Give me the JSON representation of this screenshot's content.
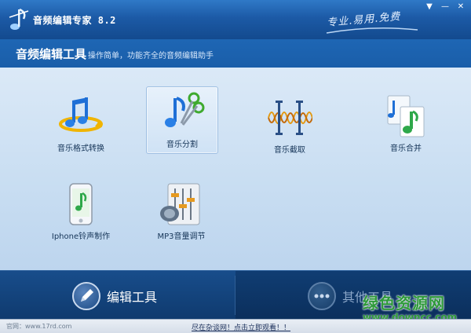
{
  "window": {
    "title": "音频编辑专家 8.2",
    "slogan": "专业.易用.免费",
    "controls": [
      "▼",
      "—",
      "✕"
    ]
  },
  "header": {
    "title": "音频编辑工具",
    "subtitle": "操作简单，功能齐全的音频编辑助手"
  },
  "tools": [
    {
      "label": "音乐格式转换",
      "icon": "music-convert-icon"
    },
    {
      "label": "音乐分割",
      "icon": "music-split-icon",
      "selected": true
    },
    {
      "label": "音乐截取",
      "icon": "music-cut-icon"
    },
    {
      "label": "音乐合并",
      "icon": "music-merge-icon"
    },
    {
      "label": "Iphone铃声制作",
      "icon": "iphone-ringtone-icon"
    },
    {
      "label": "MP3音量调节",
      "icon": "mp3-volume-icon"
    }
  ],
  "bottom_tabs": [
    {
      "label": "编辑工具",
      "icon": "pen-icon",
      "active": true
    },
    {
      "label": "其他工具",
      "icon": "more-icon",
      "active": false
    }
  ],
  "status": {
    "left": "官网：www.17rd.com",
    "center": "尽在杂谈网！点击立即观看！！"
  },
  "watermark": {
    "line1": "绿色资源网",
    "line2": "www.downcc.com"
  },
  "colors": {
    "titlebar": "#1c5aa6",
    "content_bg": "#c9def2",
    "bottom_bg": "#103d73",
    "watermark": "#2e9a3a"
  }
}
